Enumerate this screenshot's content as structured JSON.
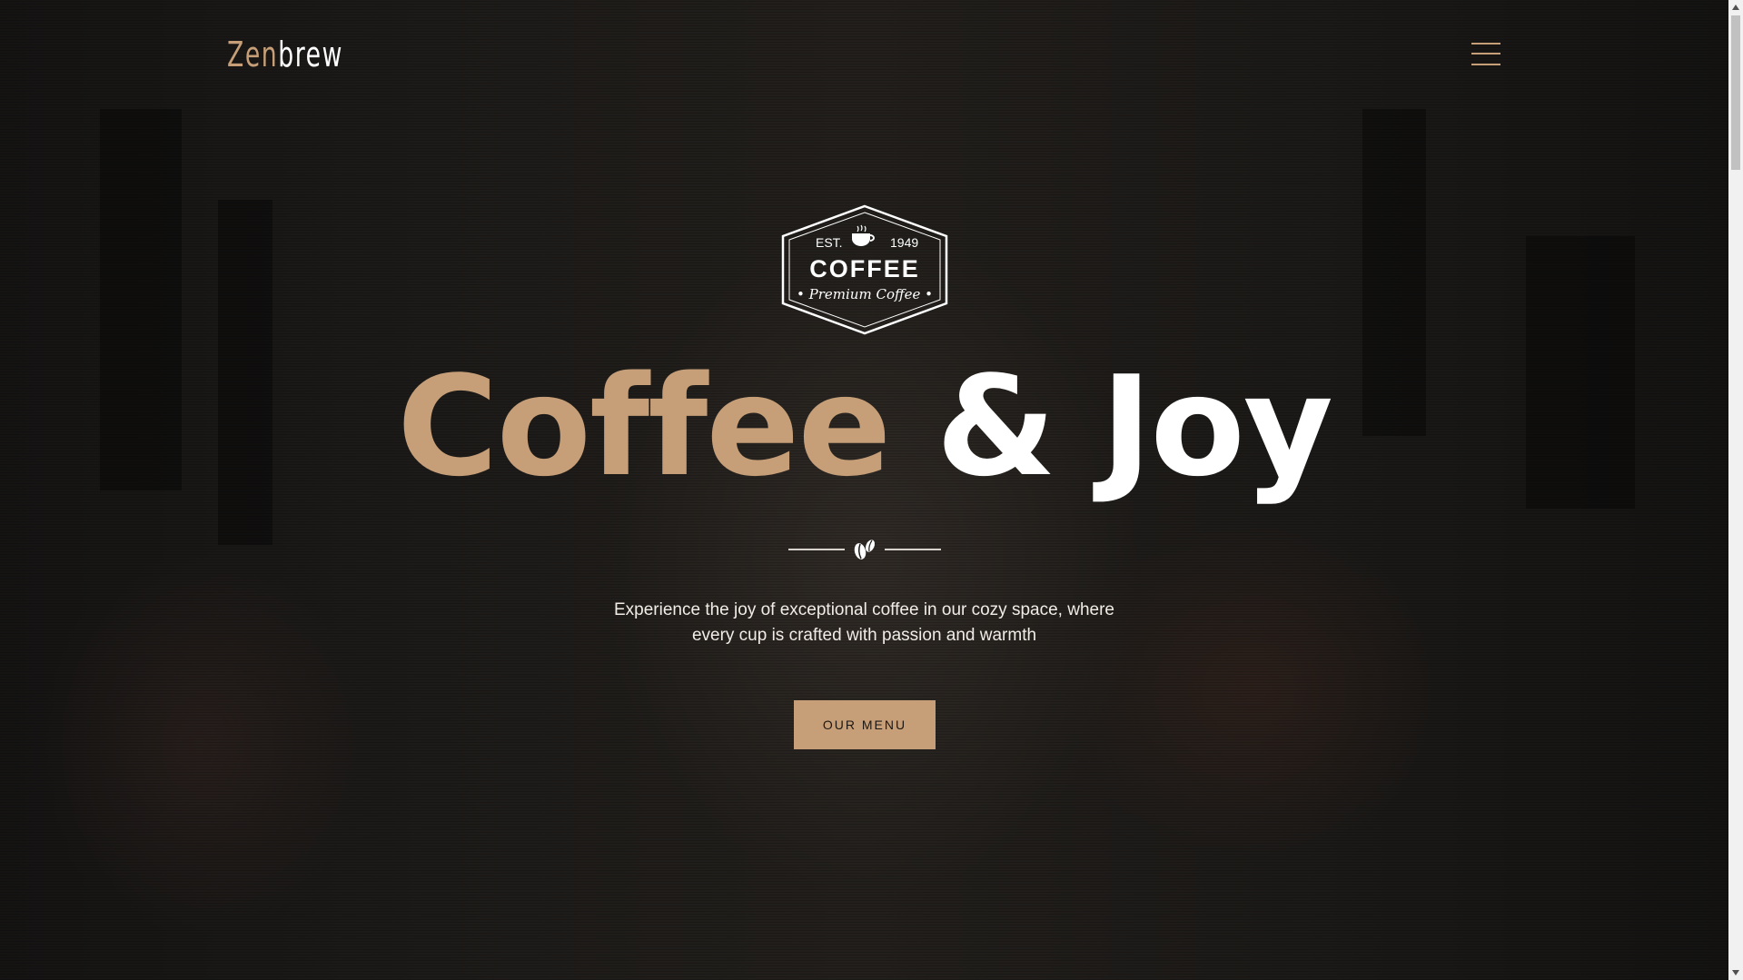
{
  "header": {
    "logo_part1": "Zen",
    "logo_part2": "brew",
    "menu_icon": "hamburger-menu-icon"
  },
  "badge": {
    "est": "EST.",
    "year": "1949",
    "title": "COFFEE",
    "subtitle": "• Premium Coffee •",
    "icon": "coffee-cup-icon"
  },
  "hero": {
    "title_part1": "Coffee",
    "title_part2": "& Joy",
    "divider_icon": "coffee-bean-icon",
    "lead_line1": "Experience the joy of exceptional coffee in our cozy space, where",
    "lead_line2": "every cup is crafted with passion and warmth",
    "cta_label": "OUR MENU"
  },
  "colors": {
    "accent": "#c69f78",
    "background": "#141210",
    "text": "#ffffff"
  }
}
